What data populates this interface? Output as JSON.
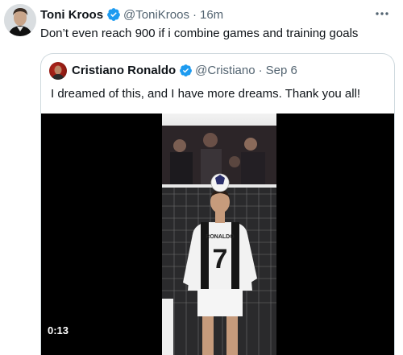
{
  "tweet": {
    "name": "Toni Kroos",
    "handle": "@ToniKroos",
    "time": "16m",
    "text": "Don’t even reach 900 if i combine games and training goals"
  },
  "quote": {
    "name": "Cristiano Ronaldo",
    "handle": "@Cristiano",
    "time": "Sep 6",
    "text": "I dreamed of this, and I have more dreams. Thank you all!",
    "video": {
      "duration": "0:13",
      "shirt_name": "RONALDO",
      "shirt_number": "7"
    }
  },
  "colors": {
    "verified": "#1d9bf0",
    "secondary_text": "#536471",
    "border": "#cfd9de"
  },
  "icons": [
    "verified-badge-icon",
    "more-options-icon"
  ]
}
